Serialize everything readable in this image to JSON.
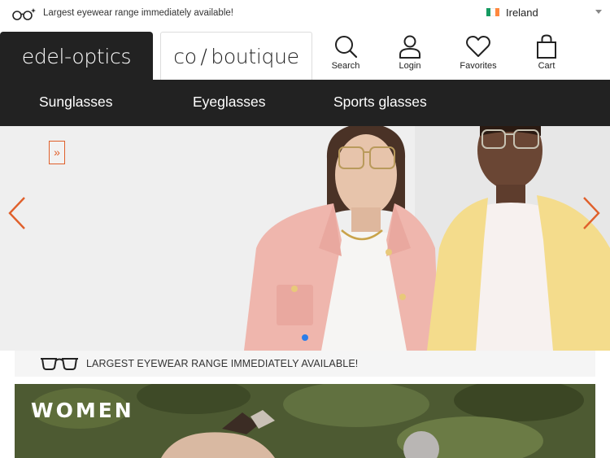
{
  "topbar": {
    "tagline": "Largest eyewear range immediately available!",
    "country": "Ireland",
    "flag_colors": [
      "#169b62",
      "#ffffff",
      "#ff883e"
    ]
  },
  "brands": {
    "edel": "edel-optics",
    "co": "co ∕ boutique"
  },
  "header_actions": [
    {
      "label": "Search",
      "icon": "search-icon"
    },
    {
      "label": "Login",
      "icon": "user-icon"
    },
    {
      "label": "Favorites",
      "icon": "heart-icon"
    },
    {
      "label": "Cart",
      "icon": "bag-icon"
    }
  ],
  "nav": [
    "Sunglasses",
    "Eyeglasses",
    "Sports glasses"
  ],
  "hero": {
    "expand_symbol": "»",
    "slides_total": 1,
    "active_slide": 1
  },
  "slogan": "LARGEST EYEWEAR RANGE IMMEDIATELY AVAILABLE!",
  "women_banner": "WOMEN",
  "colors": {
    "dark": "#222222",
    "accent_orange": "#e0602b",
    "dot_blue": "#2b7de9"
  }
}
